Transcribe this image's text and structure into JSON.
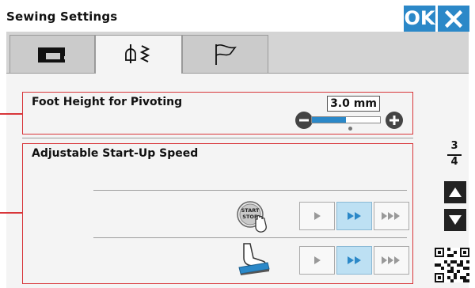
{
  "window": {
    "title": "Sewing Settings"
  },
  "header": {
    "ok_label": "OK",
    "close_icon": "close-icon"
  },
  "tabs": [
    {
      "icon": "sewing-machine-icon",
      "selected": false
    },
    {
      "icon": "presser-foot-stitch-icon",
      "selected": true
    },
    {
      "icon": "flag-icon",
      "selected": false
    }
  ],
  "foot_height": {
    "label": "Foot Height for Pivoting",
    "value": "3.0 mm",
    "slider_level": 0.5
  },
  "startup_speed": {
    "label": "Adjustable Start-Up Speed",
    "rows": [
      {
        "icon": "start-stop-button-icon",
        "start_label": "START",
        "stop_label": "STOP",
        "options": [
          "slow",
          "medium",
          "fast"
        ],
        "selected": "medium"
      },
      {
        "icon": "foot-pedal-icon",
        "options": [
          "slow",
          "medium",
          "fast"
        ],
        "selected": "medium"
      }
    ]
  },
  "pagination": {
    "current": "3",
    "total": "4"
  },
  "colors": {
    "accent": "#2b88c8",
    "outline": "#d8363a",
    "selected_option": "#bde0f3"
  }
}
